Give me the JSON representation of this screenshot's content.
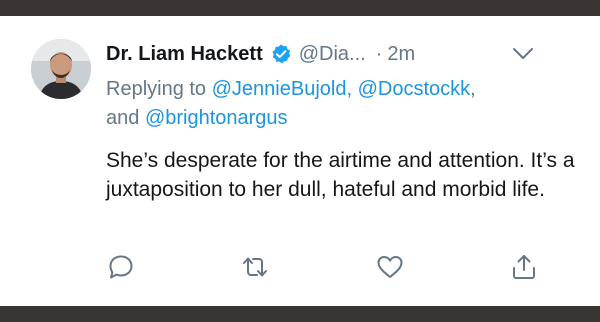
{
  "tweet": {
    "display_name": "Dr. Liam Hackett",
    "handle": "@Dia...",
    "separator": "·",
    "time": "2m",
    "replying_prefix": "Replying to",
    "reply_mentions": [
      "@JennieBujold",
      "@Docstockk",
      "@brightonargus"
    ],
    "reply_sep_1": ",",
    "reply_sep_2": ", and",
    "text": "She’s desperate for the airtime and attention. It’s a juxtaposition to her dull, hateful and morbid life."
  },
  "icons": {
    "verified": "verified-badge-icon",
    "menu": "chevron-down-icon",
    "reply": "reply-icon",
    "retweet": "retweet-icon",
    "like": "heart-icon",
    "share": "share-icon"
  },
  "colors": {
    "background": "#3a3532",
    "card": "#ffffff",
    "text": "#14171a",
    "muted": "#657786",
    "link": "#1b95e0",
    "verified": "#1da1f2"
  }
}
